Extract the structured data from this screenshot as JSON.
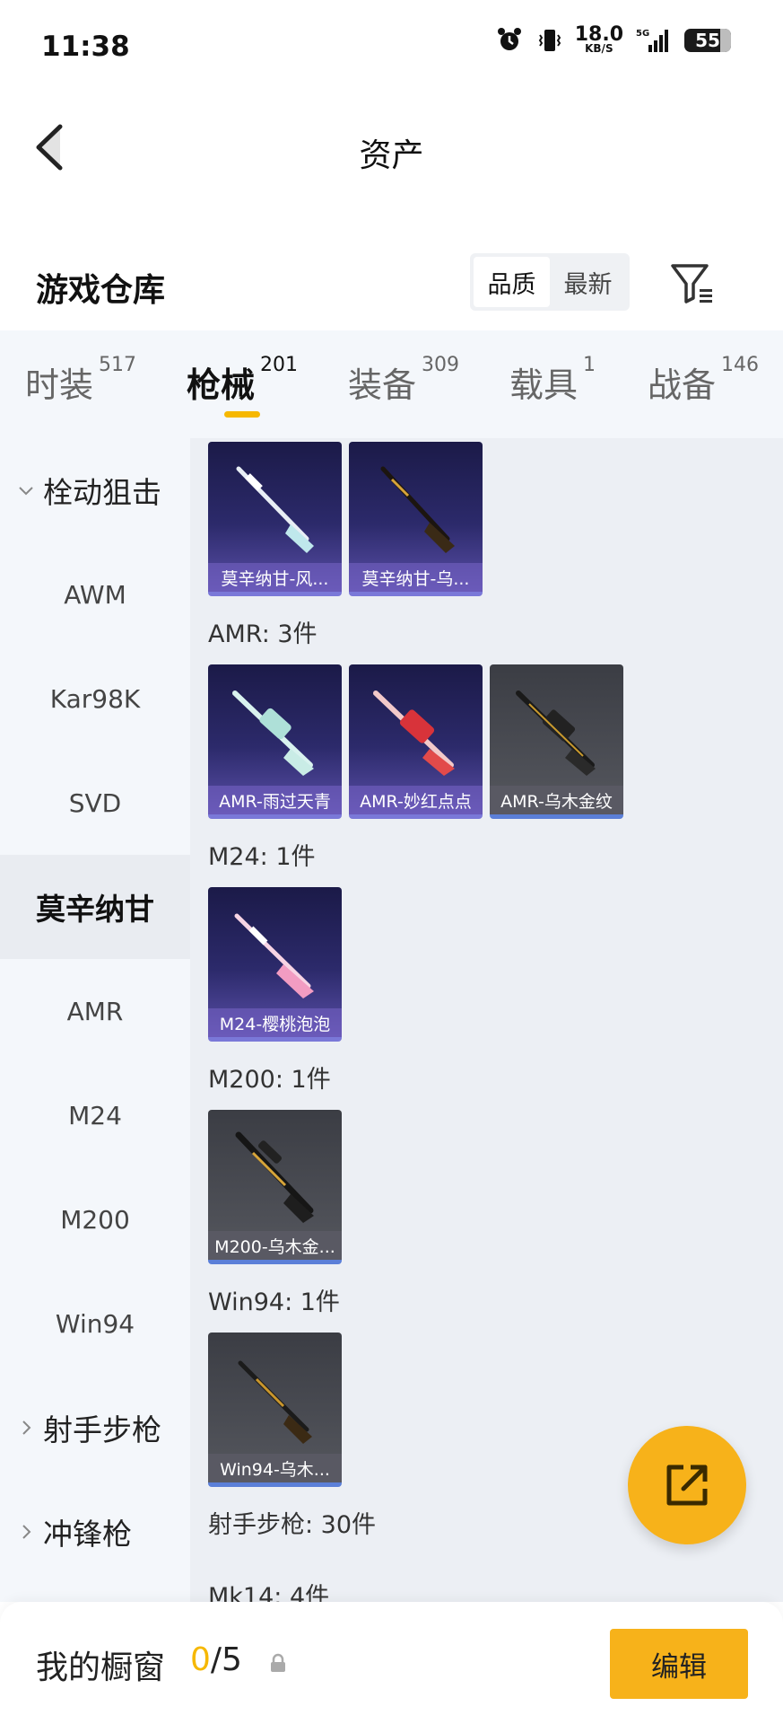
{
  "status_bar": {
    "time": "11:38",
    "net_speed": "18.0",
    "net_unit": "KB/S",
    "network": "5G",
    "battery": "55"
  },
  "header": {
    "title": "资产"
  },
  "warehouse": {
    "title": "游戏仓库",
    "sort_options": [
      "品质",
      "最新"
    ],
    "sort_selected": "品质"
  },
  "tabs": [
    {
      "label": "时装",
      "count": "517"
    },
    {
      "label": "枪械",
      "count": "201"
    },
    {
      "label": "装备",
      "count": "309"
    },
    {
      "label": "载具",
      "count": "1"
    },
    {
      "label": "战备",
      "count": "146"
    }
  ],
  "active_tab": "枪械",
  "sidebar": [
    {
      "label": "栓动狙击",
      "type": "group",
      "expanded": true
    },
    {
      "label": "AWM",
      "type": "item"
    },
    {
      "label": "Kar98K",
      "type": "item"
    },
    {
      "label": "SVD",
      "type": "item"
    },
    {
      "label": "莫辛纳甘",
      "type": "item",
      "active": true
    },
    {
      "label": "AMR",
      "type": "item"
    },
    {
      "label": "M24",
      "type": "item"
    },
    {
      "label": "M200",
      "type": "item"
    },
    {
      "label": "Win94",
      "type": "item"
    },
    {
      "label": "射手步枪",
      "type": "group",
      "expanded": false
    },
    {
      "label": "冲锋枪",
      "type": "group",
      "expanded": false
    }
  ],
  "sections": [
    {
      "label": "",
      "items": [
        "莫辛纳甘-风...",
        "莫辛纳甘-乌..."
      ]
    },
    {
      "label": "AMR: 3件",
      "items": [
        "AMR-雨过天青",
        "AMR-妙红点点",
        "AMR-乌木金纹"
      ]
    },
    {
      "label": "M24: 1件",
      "items": [
        "M24-樱桃泡泡"
      ]
    },
    {
      "label": "M200: 1件",
      "items": [
        "M200-乌木金..."
      ]
    },
    {
      "label": "Win94: 1件",
      "items": [
        "Win94-乌木..."
      ]
    },
    {
      "label": "射手步枪: 30件",
      "items": []
    },
    {
      "label": "Mk14: 4件",
      "items": []
    }
  ],
  "bottom_bar": {
    "label": "我的橱窗",
    "count_current": "0",
    "count_sep": "/",
    "count_total": "5",
    "edit_label": "编辑"
  }
}
